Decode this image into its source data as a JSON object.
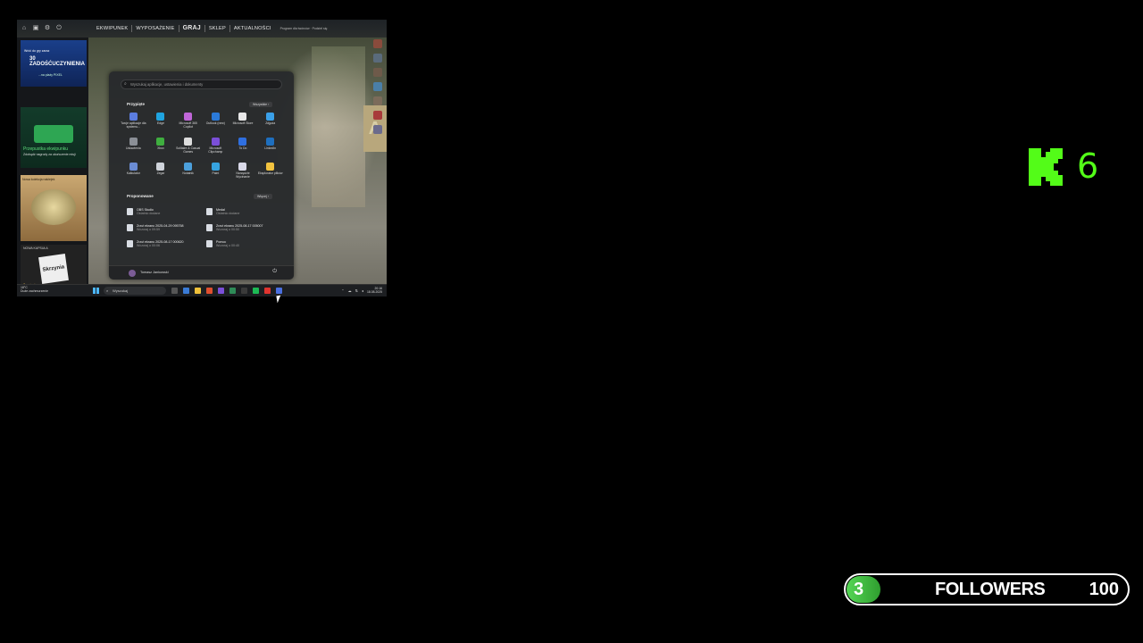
{
  "game_window": {
    "nav": [
      "EKWIPUNEK",
      "WYPOSAŻENIE",
      "GRAJ",
      "SKLEP",
      "AKTUALNOŚCI"
    ],
    "top_small_text": "Program dla twórców · Podziel się",
    "sidepanel": {
      "card1_line1": "Wróć do gry zaraz",
      "card1_title": "30 ZADOŚĆUCZYNIENIA",
      "card1_line3": "...na plaży PIXEL",
      "card2_title": "Przepustka ekwipunku",
      "card2_desc": "Zdobądź nagrody za ukończenie misji",
      "card3_caption": "Nowa kolekcja naklejek",
      "card4_title": "NOWA KAPSUŁA",
      "card4_box": "Skrzynia",
      "card4_price": "Zamów teraz"
    },
    "sign_letter": "A"
  },
  "start_menu": {
    "search_placeholder": "Wyszukaj aplikacje, ustawienia i dokumenty",
    "pinned_heading": "Przypięte",
    "pinned_button": "Wszystkie  ›",
    "pinned": [
      {
        "label": "Twoje aplikacje dla systemu...",
        "color": "#5b7de0"
      },
      {
        "label": "Edge",
        "color": "#1fa4e0"
      },
      {
        "label": "Microsoft 365 Copilot",
        "color": "#c066d8"
      },
      {
        "label": "Outlook (new)",
        "color": "#2b7ad8"
      },
      {
        "label": "Microsoft Store",
        "color": "#e8e8e8"
      },
      {
        "label": "Zdjęcia",
        "color": "#3aa0e8"
      },
      {
        "label": "Ustawienia",
        "color": "#8b8f96"
      },
      {
        "label": "Xbox",
        "color": "#3fae3f"
      },
      {
        "label": "Solitaire & Casual Games",
        "color": "#ddd"
      },
      {
        "label": "Microsoft Clipchamp",
        "color": "#7b4fd8"
      },
      {
        "label": "To Do",
        "color": "#2f6fe0"
      },
      {
        "label": "LinkedIn",
        "color": "#1e6fbf"
      },
      {
        "label": "Kalkulator",
        "color": "#6b8cd4"
      },
      {
        "label": "Zegar",
        "color": "#cfd3da"
      },
      {
        "label": "Notatnik",
        "color": "#4ca0dc"
      },
      {
        "label": "Paint",
        "color": "#36a3e0"
      },
      {
        "label": "Narzędzie Wycinanie",
        "color": "#d9d9e8"
      },
      {
        "label": "Eksplorator plików",
        "color": "#f2c33f"
      }
    ],
    "recommended_heading": "Proponowane",
    "recommended_button": "Więcej  ›",
    "recommended": [
      {
        "title": "OBS Studio",
        "sub": "Ostatnio dodane"
      },
      {
        "title": "Medal",
        "sub": "Ostatnio dodane"
      },
      {
        "title": "Zrzut ekranu 2025-04-29 095758",
        "sub": "Wczoraj o 09:59"
      },
      {
        "title": "Zrzut ekranu 2025-08-17 005007",
        "sub": "Wczoraj o 00:50"
      },
      {
        "title": "Zrzut ekranu 2025-08-17 000620",
        "sub": "Wczoraj o 00:06"
      },
      {
        "title": "Pomoc",
        "sub": "Wczoraj o 00:40"
      }
    ],
    "user_name": "Tomasz Jankowski"
  },
  "taskbar": {
    "weather_temp": "18°C",
    "weather_desc": "Duże zachmurzenie",
    "search_placeholder": "Wyszukaj",
    "time": "20:16",
    "date": "18.08.2025",
    "app_colors": [
      "#555",
      "#3a7bd5",
      "#f0c13a",
      "#e04f2f",
      "#7b4fd8",
      "#2e8b57",
      "#3a3a3a",
      "#1db954",
      "#e0342f",
      "#4a6fe0"
    ]
  },
  "overlay": {
    "kick_logo": "K",
    "kick_count": "6",
    "followers": {
      "current": "3",
      "label": "FOLLOWERS",
      "goal": "100",
      "accent": "#53fc18"
    }
  }
}
